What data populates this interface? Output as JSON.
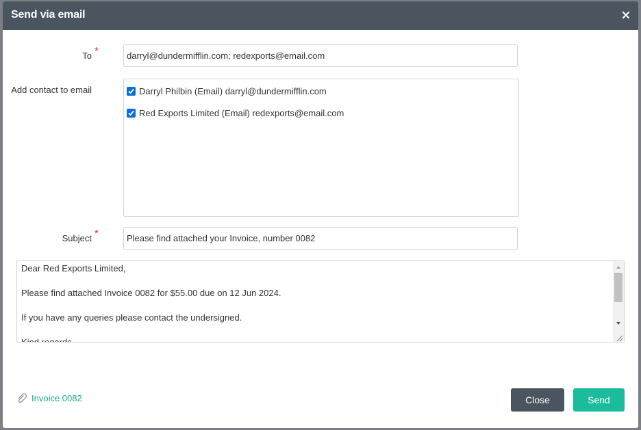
{
  "dialog": {
    "title": "Send via email",
    "close_icon": "close-icon"
  },
  "form": {
    "to_label": "To",
    "required_marker": "*",
    "to_value": "darryl@dundermifflin.com; redexports@email.com",
    "add_contact_label": "Add contact to email",
    "contacts": [
      {
        "label": "Darryl Philbin (Email) darryl@dundermifflin.com",
        "checked": true
      },
      {
        "label": "Red Exports Limited (Email) redexports@email.com",
        "checked": true
      }
    ],
    "subject_label": "Subject",
    "subject_value": "Please find attached your Invoice, number 0082",
    "body_lines": [
      "Dear Red Exports Limited,",
      "Please find attached Invoice 0082 for $55.00 due on 12 Jun 2024.",
      "If you have any queries please contact the undersigned.",
      "Kind regards"
    ]
  },
  "footer": {
    "attachment_icon": "paperclip-icon",
    "attachment_label": "Invoice 0082",
    "close_label": "Close",
    "send_label": "Send"
  },
  "colors": {
    "header_bg": "#4a5560",
    "accent": "#1abc9c",
    "required": "#d9342b",
    "checkbox": "#0b6fd8"
  }
}
